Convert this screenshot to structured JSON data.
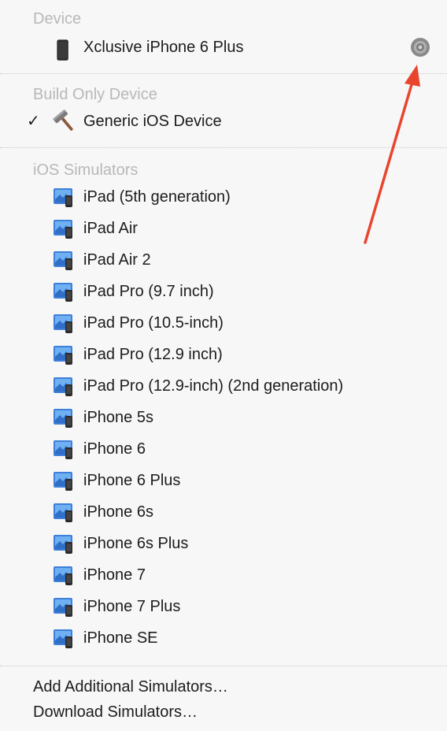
{
  "device_section": {
    "header": "Device",
    "device_name": "Xclusive iPhone 6 Plus"
  },
  "build_section": {
    "header": "Build Only Device",
    "checkmark": "✓",
    "item_label": "Generic iOS Device"
  },
  "simulators_section": {
    "header": "iOS Simulators",
    "items": [
      "iPad (5th generation)",
      "iPad Air",
      "iPad Air 2",
      "iPad Pro (9.7 inch)",
      "iPad Pro (10.5-inch)",
      "iPad Pro (12.9 inch)",
      "iPad Pro (12.9-inch) (2nd generation)",
      "iPhone 5s",
      "iPhone 6",
      "iPhone 6 Plus",
      "iPhone 6s",
      "iPhone 6s Plus",
      "iPhone 7",
      "iPhone 7 Plus",
      "iPhone SE"
    ]
  },
  "footer": {
    "add_label": "Add Additional Simulators…",
    "download_label": "Download Simulators…"
  },
  "colors": {
    "annotation_arrow": "#e8452f",
    "section_header": "#b8b8b8"
  }
}
